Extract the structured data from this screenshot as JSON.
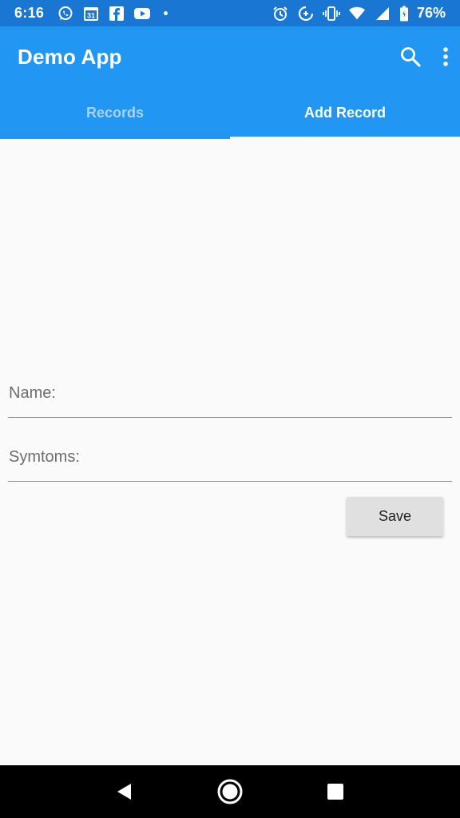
{
  "status_bar": {
    "time": "6:16",
    "battery_percent": "76%",
    "calendar_day": "31",
    "left_icons": [
      "whatsapp-icon",
      "calendar-icon",
      "facebook-icon",
      "youtube-icon",
      "dot-icon"
    ],
    "right_icons": [
      "alarm-icon",
      "data-saver-icon",
      "vibrate-icon",
      "wifi-icon",
      "signal-icon",
      "battery-icon"
    ]
  },
  "app_bar": {
    "title": "Demo App",
    "actions": [
      "search-icon",
      "more-vert-icon"
    ]
  },
  "tabs": [
    {
      "label": "Records",
      "active": false
    },
    {
      "label": "Add Record",
      "active": true
    }
  ],
  "form": {
    "name_placeholder": "Name:",
    "name_value": "",
    "symptoms_placeholder": "Symtoms:",
    "symptoms_value": "",
    "save_label": "Save"
  },
  "nav_bar": {
    "buttons": [
      "back-icon",
      "home-icon",
      "recents-icon"
    ]
  },
  "colors": {
    "status_bar": "#1976d2",
    "app_bar": "#2196f3",
    "inactive_tab_text": "#a8d4fa",
    "background": "#fafafa",
    "button": "#e0e0e0"
  }
}
